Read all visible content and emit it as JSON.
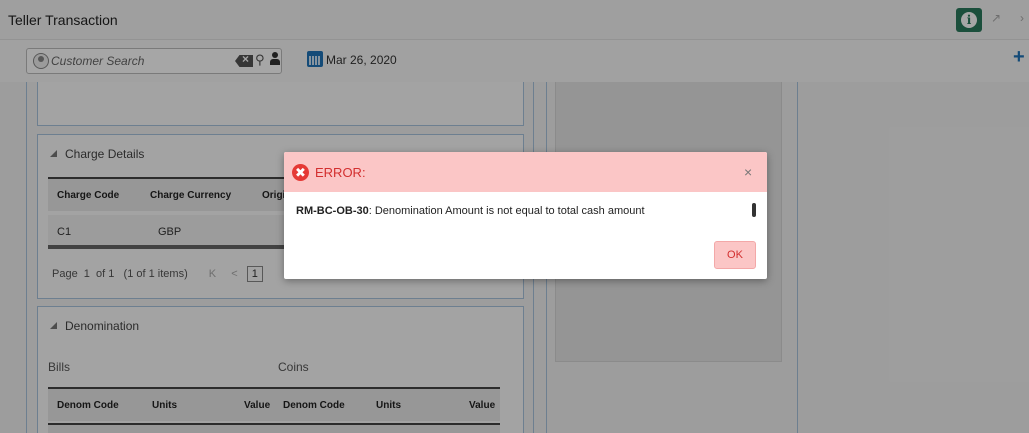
{
  "window": {
    "title": "Teller Transaction",
    "info_glyph": "i",
    "ctrl_expand": "↗",
    "ctrl_close": "›"
  },
  "toolbar": {
    "search_placeholder": "Customer Search",
    "search_glyph": "⚲",
    "date": "Mar 26, 2020",
    "add_glyph": "+"
  },
  "charge_details": {
    "header": "Charge Details",
    "columns": [
      "Charge Code",
      "Charge Currency",
      "Origi"
    ],
    "rows": [
      {
        "code": "C1",
        "currency": "GBP"
      }
    ],
    "pagination": {
      "summary": "Page  1  of 1   (1 of 1 items)",
      "first_glyph": "K",
      "prev_glyph": "<",
      "current_page": "1"
    }
  },
  "denomination": {
    "header": "Denomination",
    "bills_label": "Bills",
    "coins_label": "Coins",
    "columns": [
      "Denom Code",
      "Units",
      "Value",
      "Denom Code",
      "Units",
      "Value"
    ]
  },
  "dialog": {
    "icon_glyph": "✖",
    "title": "ERROR:",
    "close_glyph": "×",
    "error_code": "RM-BC-OB-30",
    "message": ": Denomination Amount is not equal to total cash amount",
    "ok_label": "OK"
  },
  "colors": {
    "accent_blue": "#1f74b8",
    "info_green": "#2a7a5c",
    "error_red": "#d32f2f",
    "error_bg": "#fbc6c6"
  }
}
